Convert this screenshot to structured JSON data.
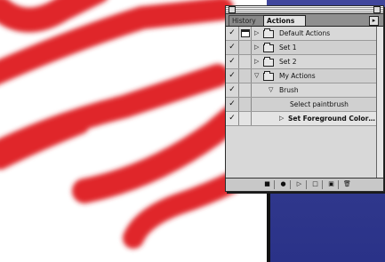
{
  "palette": {
    "tabs": [
      {
        "label": "History"
      },
      {
        "label": "Actions"
      }
    ],
    "menu_arrow": "▸",
    "rows": [
      {
        "check": "✓",
        "dialog": true,
        "disclosure": "▷",
        "folder": true,
        "label": "Default Actions"
      },
      {
        "check": "✓",
        "dialog": false,
        "disclosure": "▷",
        "folder": true,
        "label": "Set 1"
      },
      {
        "check": "✓",
        "dialog": false,
        "disclosure": "▷",
        "folder": true,
        "label": "Set 2"
      },
      {
        "check": "✓",
        "dialog": false,
        "disclosure": "▽",
        "folder": true,
        "label": "My Actions"
      },
      {
        "check": "✓",
        "dialog": false,
        "disclosure": "▽",
        "folder": false,
        "label": "Brush"
      },
      {
        "check": "✓",
        "dialog": false,
        "disclosure": "",
        "folder": false,
        "label": "Select paintbrush"
      },
      {
        "check": "✓",
        "dialog": false,
        "disclosure": "▷",
        "folder": false,
        "label": "Set Foreground Color…"
      }
    ],
    "bottom_buttons": [
      {
        "icon": "stop-icon",
        "glyph": "■"
      },
      {
        "icon": "record-icon",
        "glyph": "●"
      },
      {
        "icon": "play-icon",
        "glyph": "▷"
      },
      {
        "icon": "new-set-icon",
        "glyph": "□"
      },
      {
        "icon": "new-action-icon",
        "glyph": "▣"
      },
      {
        "icon": "trash-icon",
        "glyph": "🗑"
      }
    ]
  },
  "colors": {
    "brush_red": "#e0262b",
    "background_purple": "#3a418f"
  }
}
